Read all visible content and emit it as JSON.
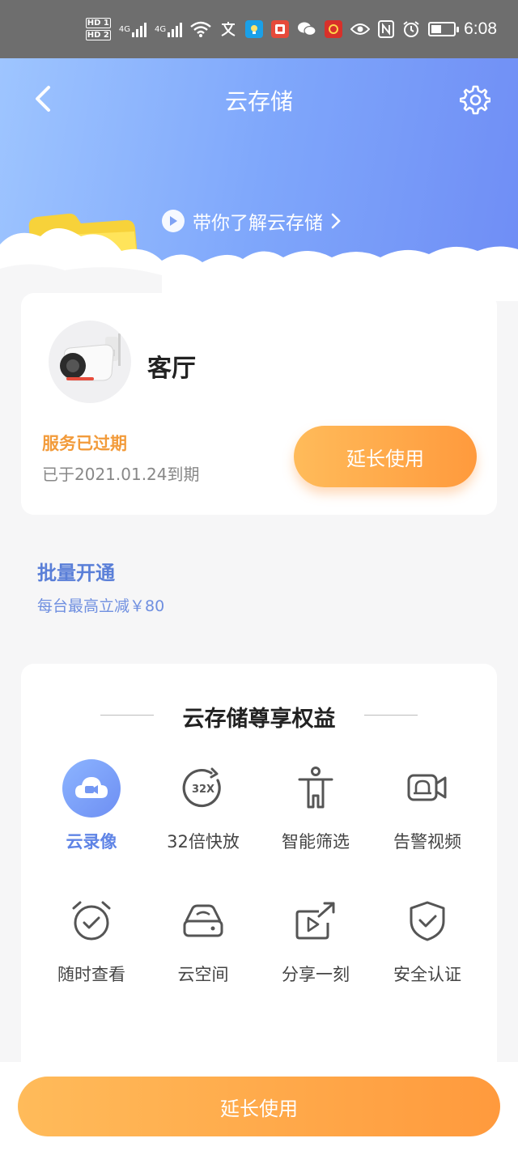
{
  "status_bar": {
    "hd_top": "HD 1",
    "hd_bottom": "HD 2",
    "net1": "4G",
    "net2": "4G",
    "time": "6:08",
    "icons": [
      "hd-icon",
      "signal-icon",
      "signal-icon",
      "wifi-icon",
      "translate-icon",
      "app-icon",
      "app-icon",
      "wechat-icon",
      "app-icon",
      "eye-icon",
      "nfc-icon",
      "alarm-icon",
      "battery-icon"
    ]
  },
  "header": {
    "title": "云存储",
    "intro_link": "带你了解云存储"
  },
  "device": {
    "name": "客厅",
    "status": "服务已过期",
    "expire_text": "已于2021.01.24到期",
    "extend_label": "延长使用"
  },
  "batch": {
    "title": "批量开通",
    "subtitle": "每台最高立减￥80"
  },
  "benefits": {
    "title": "云存储尊享权益",
    "items": [
      {
        "label": "云录像",
        "icon": "cloud-video-icon",
        "active": true
      },
      {
        "label": "32倍快放",
        "icon": "speed-32x-icon",
        "active": false
      },
      {
        "label": "智能筛选",
        "icon": "person-filter-icon",
        "active": false
      },
      {
        "label": "告警视频",
        "icon": "alarm-video-icon",
        "active": false
      },
      {
        "label": "随时查看",
        "icon": "clock-check-icon",
        "active": false
      },
      {
        "label": "云空间",
        "icon": "cloud-disk-icon",
        "active": false
      },
      {
        "label": "分享一刻",
        "icon": "share-video-icon",
        "active": false
      },
      {
        "label": "安全认证",
        "icon": "shield-check-icon",
        "active": false
      }
    ]
  },
  "bottom": {
    "button_label": "延长使用"
  },
  "colors": {
    "accent_blue": "#6f8df5",
    "accent_orange": "#ff9a3d",
    "status_orange": "#f29b3b",
    "batch_blue": "#5a7fd8"
  }
}
